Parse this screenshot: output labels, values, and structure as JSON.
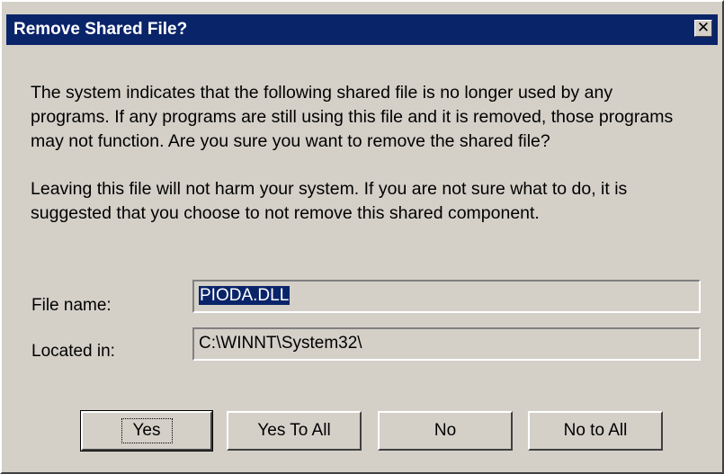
{
  "dialog": {
    "title": "Remove Shared File?",
    "close_label": "✕",
    "message_primary": "The system indicates that the following shared file is no longer used by any programs.  If any programs are still using this file and it is removed, those programs may not function.  Are you sure you want to remove the shared file?",
    "message_secondary": "Leaving this file will not harm your system.  If you are not sure what to do, it is suggested that you choose to not remove this shared component."
  },
  "fields": {
    "file_name_label": "File name:",
    "file_name_value": "PIODA.DLL",
    "located_in_label": "Located in:",
    "located_in_value": "C:\\WINNT\\System32\\"
  },
  "buttons": {
    "yes_label": "Yes",
    "yes_to_all_label": "Yes To All",
    "no_label": "No",
    "no_to_all_label": "No to All"
  },
  "colors": {
    "titlebar": "#0a246a",
    "dialog_face": "#d4d0c8",
    "selection": "#0a246a"
  }
}
